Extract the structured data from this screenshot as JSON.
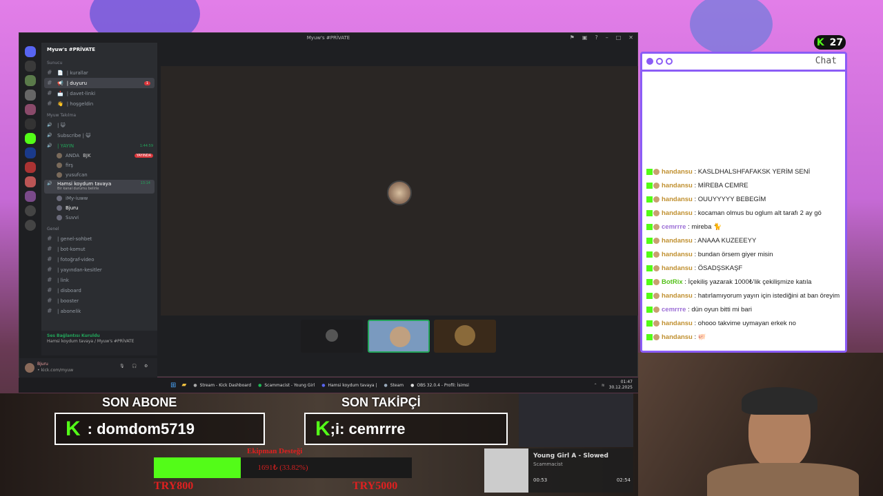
{
  "window": {
    "title": "Myuw's #PRİVATE"
  },
  "server": {
    "name": "Myuw's #PRİVATE"
  },
  "categories": {
    "sunucu": "Sunucu",
    "takilma": "Myuw Takılma",
    "genel": "Genel"
  },
  "sunucu_channels": [
    {
      "icon": "📄",
      "label": "| kurallar"
    },
    {
      "icon": "📢",
      "label": "| duyuru",
      "badge": "1"
    },
    {
      "icon": "📩",
      "label": "| davet-linki"
    },
    {
      "icon": "👋",
      "label": "| hoşgeldin"
    }
  ],
  "takilma_channels": [
    {
      "label": "| 😺"
    },
    {
      "label": "Subscribe | 😺"
    },
    {
      "label": "| YAYIN",
      "time": "1:44:59",
      "live_badge": "YAYINDA"
    }
  ],
  "yayin_users": [
    "ANDA",
    "firş",
    "yusufcan"
  ],
  "yayin_extra": "BJK",
  "hamsi": {
    "label": "Hamsi koydum tavaya",
    "time": "13:14",
    "sub": "Bir kanal durumu belirle"
  },
  "hamsi_users": [
    "iMy-iuww",
    "Bjuru",
    "Suvvi"
  ],
  "genel_channels": [
    "| genel-sohbet",
    "| bot-komut",
    "| fotoğraf-video",
    "| yayından-kesitler",
    "| link",
    "| disboard",
    "| booster",
    "| abonelik"
  ],
  "voice": {
    "status": "Ses Bağlantısı Kuruldu",
    "channel": "Hamsi koydum tavaya / Myuw's #PRİVATE"
  },
  "user": {
    "name": "Bjuru",
    "sub": "• kick.com/myuw"
  },
  "taskbar": {
    "items": [
      "Stream - Kick Dashboard",
      "Scammacist - Young Girl",
      "Hamsi koydum tavaya |",
      "Steam",
      "OBS 32.0.4 - Profil: İsimsi"
    ],
    "time": "01:47",
    "date": "30.12.2025"
  },
  "kick_count": "27",
  "chat": {
    "title": "Chat",
    "messages": [
      {
        "user": "handansu",
        "text": "KASLDHALSHFAFAKSK YERİM SENİ"
      },
      {
        "user": "handansu",
        "text": "MİREBA CEMRE"
      },
      {
        "user": "handansu",
        "text": "OUUYYYYY BEBEGİM"
      },
      {
        "user": "handansu",
        "text": "kocaman olmus bu oglum alt tarafı 2 ay gö"
      },
      {
        "user": "cemrrre",
        "text": "mireba 🐈"
      },
      {
        "user": "handansu",
        "text": "ANAAA KUZEEEYY"
      },
      {
        "user": "handansu",
        "text": "bundan örsem giyer misin"
      },
      {
        "user": "handansu",
        "text": "ÖSADŞSKAŞF"
      },
      {
        "user": "BotRix",
        "text": "İçekiliş yazarak 1000₺'lik çekilişmize katıla"
      },
      {
        "user": "handansu",
        "text": "hatırlamıyorum yayın için istediğini at ban öreyim"
      },
      {
        "user": "cemrrre",
        "text": "dün oyun bitti mi bari"
      },
      {
        "user": "handansu",
        "text": "ohooo takvime uymayan erkek no"
      },
      {
        "user": "handansu",
        "text": "🐖"
      }
    ]
  },
  "overlay": {
    "sub_header": "SON ABONE",
    "sub_name": ": domdom5719",
    "follow_header": "SON TAKİPÇİ",
    "follow_name": ";i: cemrrre",
    "goal_title": "Ekipman Desteği",
    "goal_text": "1691₺ (33.82%)",
    "goal_progress": 0.3382,
    "goal_min": "TRY800",
    "goal_max": "TRY5000"
  },
  "music": {
    "title": "Young Girl A - Slowed",
    "artist": "Scammacist",
    "elapsed": "00:53",
    "total": "02:54"
  },
  "colors": {
    "kick_green": "#53fc18",
    "chat_purple": "#8b5cf6",
    "user_gold": "#c09030",
    "user_purple": "#9c6fd6",
    "user_green": "#53c018"
  }
}
